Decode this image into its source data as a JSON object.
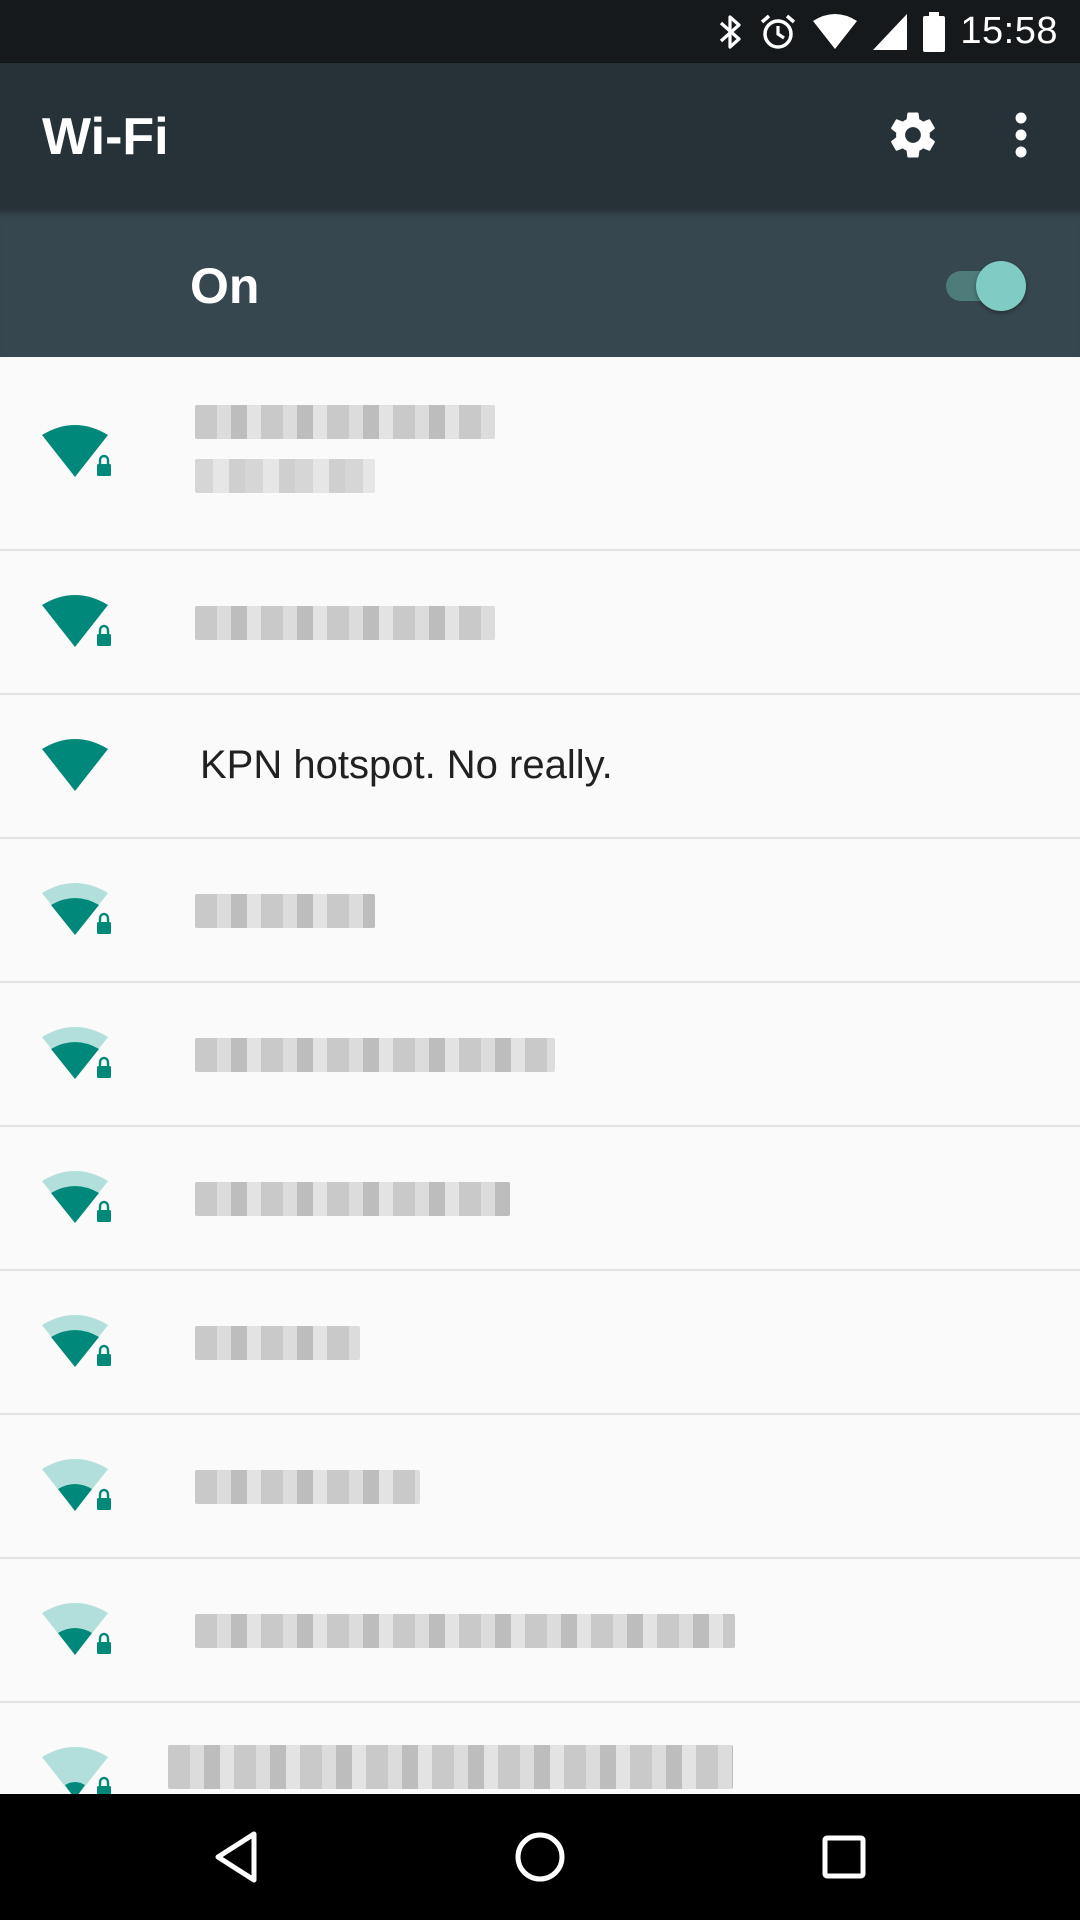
{
  "status_bar": {
    "time": "15:58",
    "icons": [
      "bluetooth-icon",
      "alarm-icon",
      "wifi-signal-icon",
      "cell-signal-icon",
      "battery-icon"
    ]
  },
  "app_bar": {
    "title": "Wi-Fi",
    "actions": [
      "settings-icon",
      "more-vert-icon"
    ]
  },
  "master_switch": {
    "label": "On",
    "state": "on",
    "accent_color": "#80cbc4"
  },
  "networks": [
    {
      "name": "",
      "secured": true,
      "signal_level": 4,
      "name_redacted": true,
      "has_subtitle": true
    },
    {
      "name": "",
      "secured": true,
      "signal_level": 4,
      "name_redacted": true
    },
    {
      "name": "KPN hotspot. No really.",
      "secured": false,
      "signal_level": 4,
      "name_redacted": false
    },
    {
      "name": "",
      "secured": true,
      "signal_level": 3,
      "name_redacted": true
    },
    {
      "name": "",
      "secured": true,
      "signal_level": 3,
      "name_redacted": true
    },
    {
      "name": "",
      "secured": true,
      "signal_level": 3,
      "name_redacted": true
    },
    {
      "name": "",
      "secured": true,
      "signal_level": 3,
      "name_redacted": true
    },
    {
      "name": "",
      "secured": true,
      "signal_level": 2,
      "name_redacted": true
    },
    {
      "name": "",
      "secured": true,
      "signal_level": 2,
      "name_redacted": true
    },
    {
      "name": "",
      "secured": true,
      "signal_level": 1,
      "name_redacted": true
    }
  ],
  "colors": {
    "wifi_strong": "#00897b",
    "wifi_weak": "#b2dfdb",
    "app_bar": "#263238",
    "switch_bar": "#37474f"
  },
  "nav_bar": {
    "buttons": [
      "back-icon",
      "home-icon",
      "recents-icon"
    ]
  }
}
